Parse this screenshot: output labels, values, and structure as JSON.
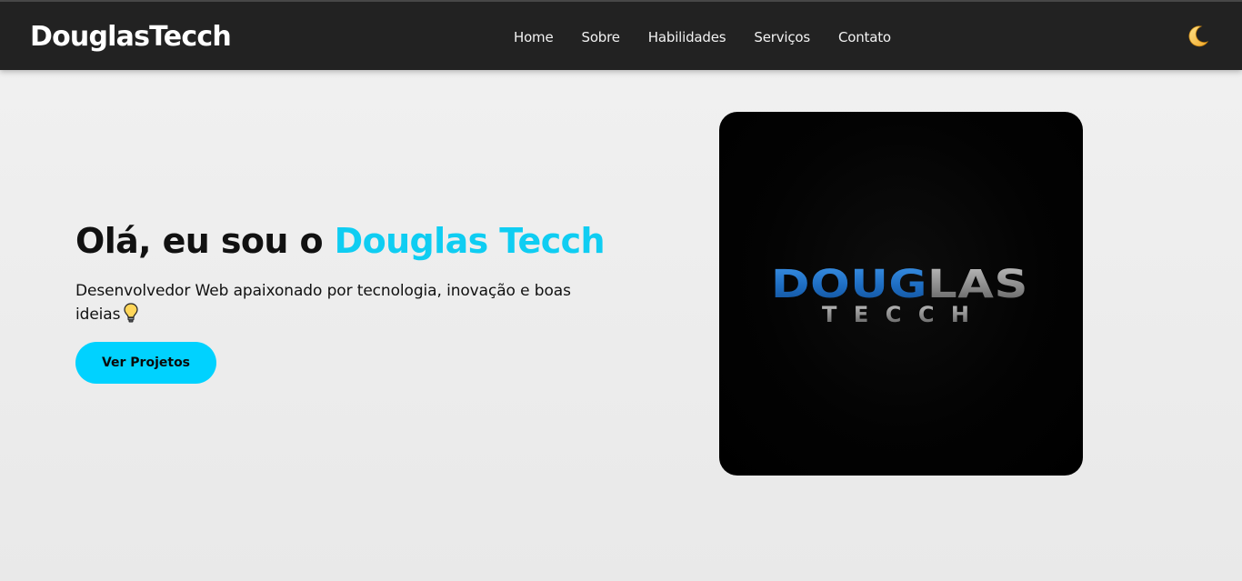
{
  "header": {
    "brand": "DouglasTecch",
    "nav": [
      "Home",
      "Sobre",
      "Habilidades",
      "Serviços",
      "Contato"
    ],
    "theme_toggle_icon": "moon-icon"
  },
  "hero": {
    "title_prefix": "Olá, eu sou o ",
    "title_highlight": "Douglas Tecch",
    "subtitle": "Desenvolvedor Web apaixonado por tecnologia, inovação e boas ideias",
    "subtitle_icon": "lightbulb-icon",
    "cta_label": "Ver Projetos"
  },
  "logo": {
    "line1_blue": "DOUG",
    "line1_gray": "LAS",
    "line2": "TECCH"
  },
  "colors": {
    "header_bg": "#222222",
    "accent": "#0fcdf2",
    "button_bg": "#00d2ff",
    "page_bg": "#efefef",
    "logo_blue": "#1f6fc4",
    "logo_gray": "#8a8a8a"
  }
}
